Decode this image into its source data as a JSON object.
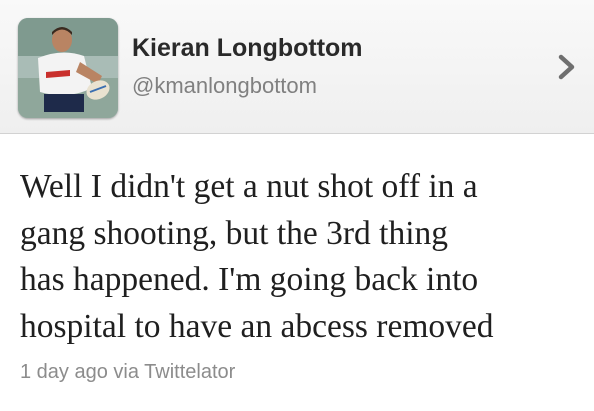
{
  "profile": {
    "display_name": "Kieran Longbottom",
    "handle": "@kmanlongbottom",
    "avatar_icon": "rugby-player-avatar"
  },
  "tweet": {
    "lines": [
      "Well I didn't get a nut shot off in a",
      "gang shooting, but the 3rd thing",
      "has happened. I'm going back into",
      "hospital to have an abcess removed"
    ],
    "timestamp": "1 day ago",
    "via_text": "via Twittelator"
  },
  "icons": {
    "disclosure": "chevron-right-icon"
  },
  "colors": {
    "header_bg": "#f4f4f4",
    "name": "#2a2a2a",
    "handle": "#808080",
    "text": "#1f1f1f",
    "meta": "#8c8c8c"
  }
}
